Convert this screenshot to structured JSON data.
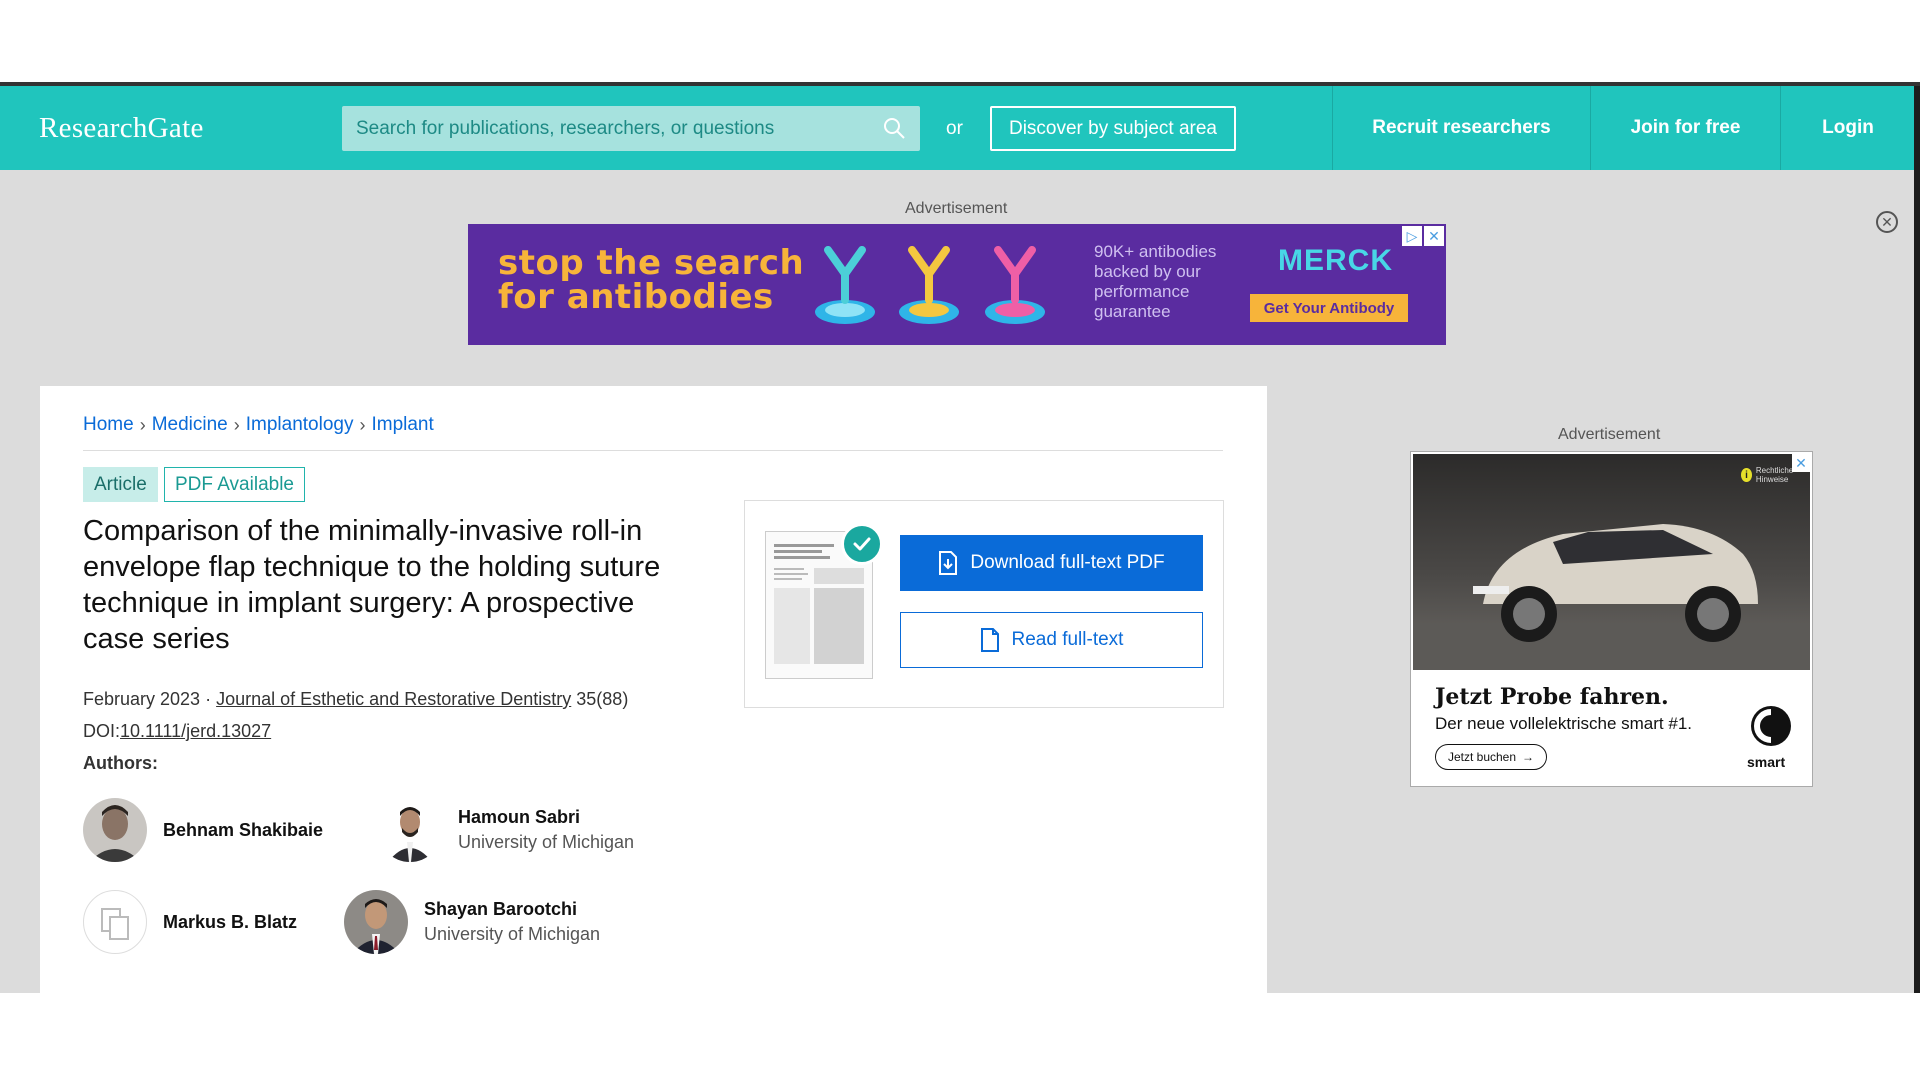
{
  "brand": {
    "logo": "ResearchGate",
    "accent": "#20c5bd"
  },
  "header": {
    "search_placeholder": "Search for publications, researchers, or questions",
    "search_icon": "search-icon",
    "or_label": "or",
    "discover_label": "Discover by subject area",
    "nav": {
      "recruit": "Recruit researchers",
      "join": "Join for free",
      "login": "Login"
    }
  },
  "ad_top": {
    "label": "Advertisement",
    "headline_line1": "stop the search",
    "headline_line2": "for antibodies",
    "copy_line1": "90K+ antibodies",
    "copy_line2": "backed by our",
    "copy_line3": "performance",
    "copy_line4": "guarantee",
    "brand": "MERCK",
    "cta": "Get Your Antibody"
  },
  "breadcrumb": [
    "Home",
    "Medicine",
    "Implantology",
    "Implant"
  ],
  "tags": {
    "article": "Article",
    "pdf": "PDF Available"
  },
  "article": {
    "title": "Comparison of the minimally-invasive roll-in envelope flap technique to the holding suture technique in implant surgery: A prospective case series",
    "date": "February 2023",
    "journal": "Journal of Esthetic and Restorative Dentistry",
    "volume": "35(88)",
    "doi_label": "DOI:",
    "doi": "10.1111/jerd.13027",
    "authors_label": "Authors:",
    "authors": [
      {
        "name": "Behnam Shakibaie",
        "affiliation": ""
      },
      {
        "name": "Hamoun Sabri",
        "affiliation": "University of Michigan"
      },
      {
        "name": "Markus B. Blatz",
        "affiliation": ""
      },
      {
        "name": "Shayan Barootchi",
        "affiliation": "University of Michigan"
      }
    ]
  },
  "pdf_actions": {
    "download": "Download full-text PDF",
    "read": "Read full-text"
  },
  "ad_right": {
    "label": "Advertisement",
    "info_text": "Rechtliche Hinweise",
    "headline": "Jetzt Probe fahren.",
    "sub": "Der neue vollelektrische smart #1.",
    "cta": "Jetzt buchen",
    "brand": "smart"
  }
}
